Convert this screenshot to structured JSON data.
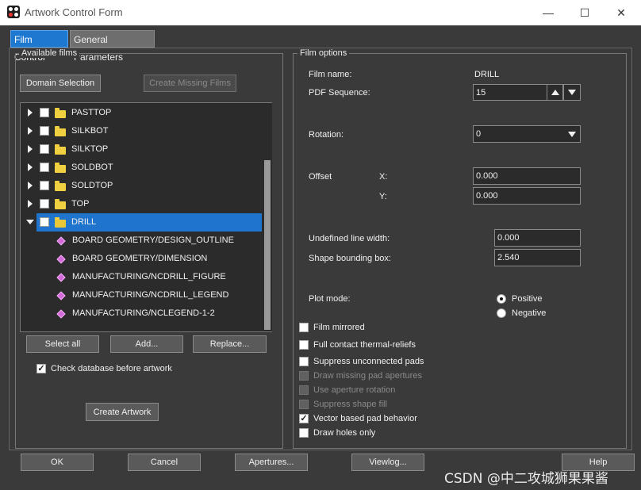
{
  "window": {
    "title": "Artwork Control Form",
    "minimize_glyph": "—",
    "maximize_glyph": "☐",
    "close_glyph": "✕"
  },
  "tabs": [
    {
      "label": "Film Control",
      "active": true
    },
    {
      "label": "General Parameters",
      "active": false
    }
  ],
  "available_films": {
    "group_label": "Available films",
    "domain_selection": "Domain Selection",
    "create_missing_films": "Create Missing Films",
    "films": [
      {
        "name": "PASTTOP",
        "expanded": false,
        "checked": false
      },
      {
        "name": "SILKBOT",
        "expanded": false,
        "checked": false
      },
      {
        "name": "SILKTOP",
        "expanded": false,
        "checked": false
      },
      {
        "name": "SOLDBOT",
        "expanded": false,
        "checked": false
      },
      {
        "name": "SOLDTOP",
        "expanded": false,
        "checked": false
      },
      {
        "name": "TOP",
        "expanded": false,
        "checked": false
      },
      {
        "name": "DRILL",
        "expanded": true,
        "checked": false,
        "selected": true
      }
    ],
    "drill_layers": [
      "BOARD GEOMETRY/DESIGN_OUTLINE",
      "BOARD GEOMETRY/DIMENSION",
      "MANUFACTURING/NCDRILL_FIGURE",
      "MANUFACTURING/NCDRILL_LEGEND",
      "MANUFACTURING/NCLEGEND-1-2"
    ],
    "select_all": "Select all",
    "add": "Add...",
    "replace": "Replace...",
    "check_database_label": "Check database before artwork",
    "check_database_checked": true,
    "create_artwork": "Create Artwork"
  },
  "film_options": {
    "group_label": "Film options",
    "film_name_label": "Film name:",
    "film_name_value": "DRILL",
    "pdf_sequence_label": "PDF Sequence:",
    "pdf_sequence_value": "15",
    "rotation_label": "Rotation:",
    "rotation_value": "0",
    "offset_label": "Offset",
    "x_label": "X:",
    "x_value": "0.000",
    "y_label": "Y:",
    "y_value": "0.000",
    "undefined_line_width_label": "Undefined line width:",
    "undefined_line_width_value": "0.000",
    "shape_bounding_box_label": "Shape bounding box:",
    "shape_bounding_box_value": "2.540",
    "plot_mode_label": "Plot mode:",
    "positive_label": "Positive",
    "negative_label": "Negative",
    "plot_mode_selected": "Positive",
    "options": [
      {
        "label": "Film mirrored",
        "checked": false,
        "enabled": true
      },
      {
        "label": "Full contact thermal-reliefs",
        "checked": false,
        "enabled": true
      },
      {
        "label": "Suppress unconnected pads",
        "checked": false,
        "enabled": true
      },
      {
        "label": "Draw missing pad apertures",
        "checked": false,
        "enabled": false
      },
      {
        "label": "Use aperture rotation",
        "checked": false,
        "enabled": false
      },
      {
        "label": "Suppress shape fill",
        "checked": false,
        "enabled": false
      },
      {
        "label": "Vector based pad behavior",
        "checked": true,
        "enabled": true
      },
      {
        "label": "Draw holes only",
        "checked": false,
        "enabled": true
      }
    ]
  },
  "footer": {
    "ok": "OK",
    "cancel": "Cancel",
    "apertures": "Apertures...",
    "viewlog": "Viewlog...",
    "help": "Help"
  },
  "watermark": "CSDN @中二攻城狮果果酱",
  "colors": {
    "background": "#3a3a3a",
    "selection": "#1f74cd",
    "active_tab": "#1e78d0",
    "folder": "#f0d040",
    "layer_icon": "#d46ad8"
  }
}
